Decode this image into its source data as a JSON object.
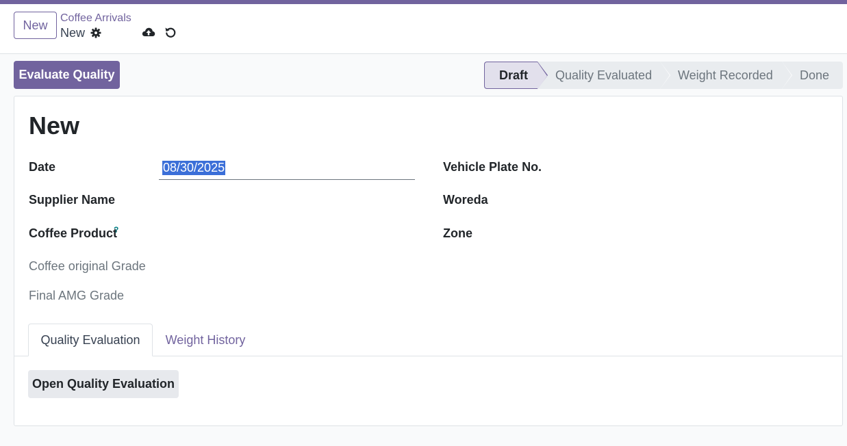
{
  "control_panel": {
    "new_button": "New",
    "breadcrumb": "Coffee Arrivals",
    "record_name": "New"
  },
  "actions": {
    "evaluate_quality": "Evaluate Quality"
  },
  "statusbar": {
    "stages": [
      "Draft",
      "Quality Evaluated",
      "Weight Recorded",
      "Done"
    ],
    "active": "Draft"
  },
  "form": {
    "title": "New",
    "left_fields": {
      "date_label": "Date",
      "date_value": "08/30/2025",
      "supplier_label": "Supplier Name",
      "product_label": "Coffee Product",
      "product_help": "?",
      "original_grade_label": "Coffee original Grade",
      "final_grade_label": "Final AMG Grade"
    },
    "right_fields": {
      "vehicle_label": "Vehicle Plate No.",
      "woreda_label": "Woreda",
      "zone_label": "Zone"
    },
    "tabs": [
      "Quality Evaluation",
      "Weight History"
    ],
    "active_tab": "Quality Evaluation",
    "tab_button": "Open Quality Evaluation"
  },
  "colors": {
    "brand": "#71639e",
    "selection": "#3b6fd8"
  },
  "icons": [
    "gear-icon",
    "cloud-upload-icon",
    "undo-icon"
  ]
}
